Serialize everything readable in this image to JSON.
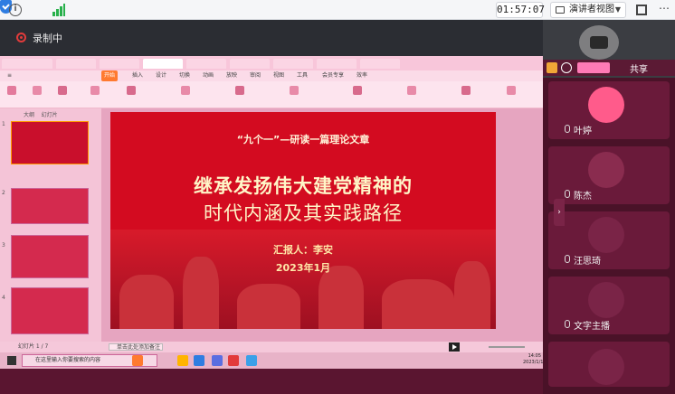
{
  "topbar": {
    "timer": "01:57:07",
    "view_mode": "演讲者视图"
  },
  "recording": {
    "label": "录制中"
  },
  "participants": {
    "share_label": "共享",
    "members": [
      {
        "name": "叶婷"
      },
      {
        "name": "陈杰"
      },
      {
        "name": "汪思琦"
      },
      {
        "name": "文字主播"
      }
    ]
  },
  "wps": {
    "menu": [
      "开始",
      "插入",
      "设计",
      "切换",
      "动画",
      "放映",
      "审阅",
      "视图",
      "工具",
      "会员专享",
      "效率"
    ],
    "active_menu": "开始",
    "thumb_tabs": [
      "大纲",
      "幻灯片"
    ],
    "notes_placeholder": "单击此处添加备注",
    "slide_counter": "幻灯片 1 / 7"
  },
  "slide": {
    "subtitle": "“九个一”—研读一篇理论文章",
    "title_line1": "继承发扬伟大建党精神的",
    "title_line2": "时代内涵及其实践路径",
    "presenter": "汇报人：李安",
    "date": "2023年1月"
  },
  "taskbar": {
    "search_placeholder": "在这里输入你要搜索的内容",
    "time": "14:05",
    "date": "2023/1/14"
  },
  "colors": {
    "slide_red": "#d30b20",
    "title_gold": "#fff6c8",
    "panel_bg": "#4a1228",
    "accent_orange": "#ff7a30"
  }
}
